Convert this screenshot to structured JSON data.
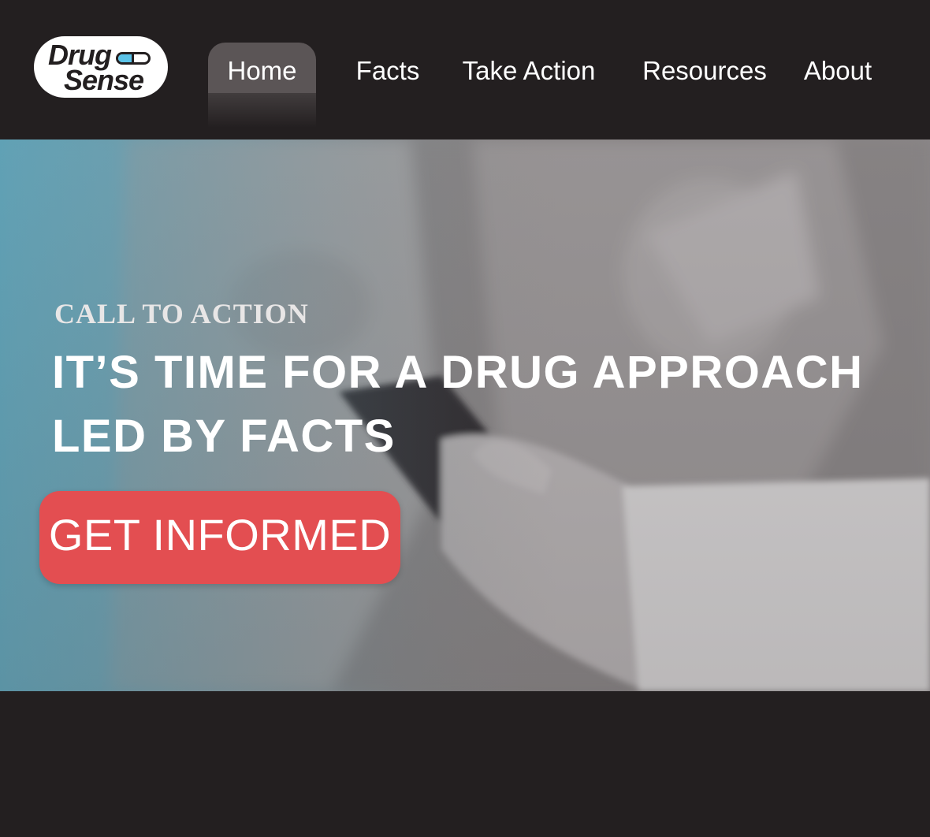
{
  "brand": {
    "logo_word_1": "Drug",
    "logo_word_2": "Sense",
    "pill_color": "#5bc3e8"
  },
  "nav": {
    "items": [
      {
        "label": "Home",
        "active": true
      },
      {
        "label": "Facts",
        "active": false
      },
      {
        "label": "Take Action",
        "active": false
      },
      {
        "label": "Resources",
        "active": false
      },
      {
        "label": "About",
        "active": false
      }
    ]
  },
  "hero": {
    "eyebrow": "CALL TO ACTION",
    "headline_line_1": "IT’S TIME FOR A DRUG APPROACH",
    "headline_line_2": "LED BY FACTS",
    "cta_label": "GET INFORMED",
    "image_description_icon": "hands-holding-phone-photo"
  },
  "colors": {
    "background": "#231f20",
    "nav_active": "#5b5556",
    "cta": "#e34e51",
    "text": "#ffffff"
  }
}
